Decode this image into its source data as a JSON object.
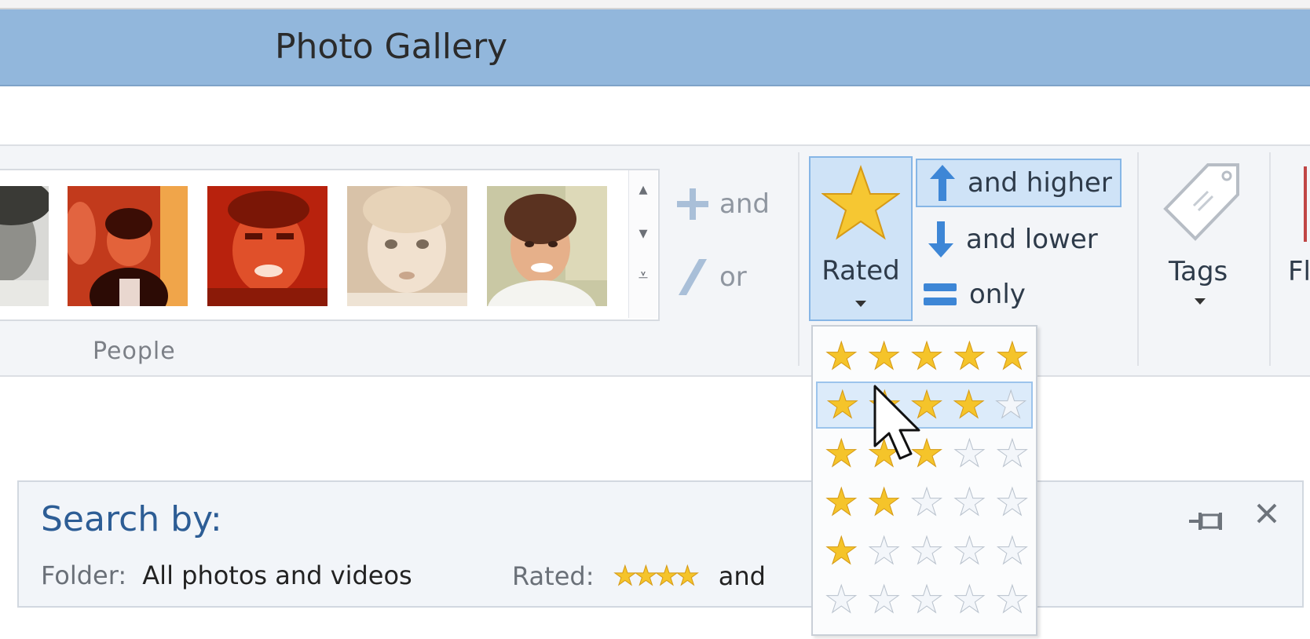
{
  "window": {
    "title": "Photo Gallery"
  },
  "ribbon": {
    "people_group_label": "People",
    "logic": {
      "and_label": "and",
      "or_label": "or"
    },
    "rated_label": "Rated",
    "compare": {
      "higher": "and higher",
      "lower": "and lower",
      "only": "only"
    },
    "tags_label": "Tags",
    "flag_label_partial": "Fl",
    "people_thumbnails": [
      "person-photo-1",
      "person-photo-2",
      "person-photo-3",
      "person-photo-4",
      "person-photo-5"
    ]
  },
  "rating_dropdown": {
    "options": [
      5,
      4,
      3,
      2,
      1,
      0
    ],
    "max_stars": 5,
    "hovered_index": 1
  },
  "search_panel": {
    "title": "Search by:",
    "folder_label": "Folder:",
    "folder_value": "All photos and videos",
    "rated_label": "Rated:",
    "rated_stars": 4,
    "rated_suffix": "and"
  },
  "colors": {
    "titlebar": "#92b7dc",
    "selected_fill": "#cfe3f7",
    "selected_border": "#86b6e6",
    "star_gold": "#f5c42a",
    "search_title": "#2d5d95"
  }
}
